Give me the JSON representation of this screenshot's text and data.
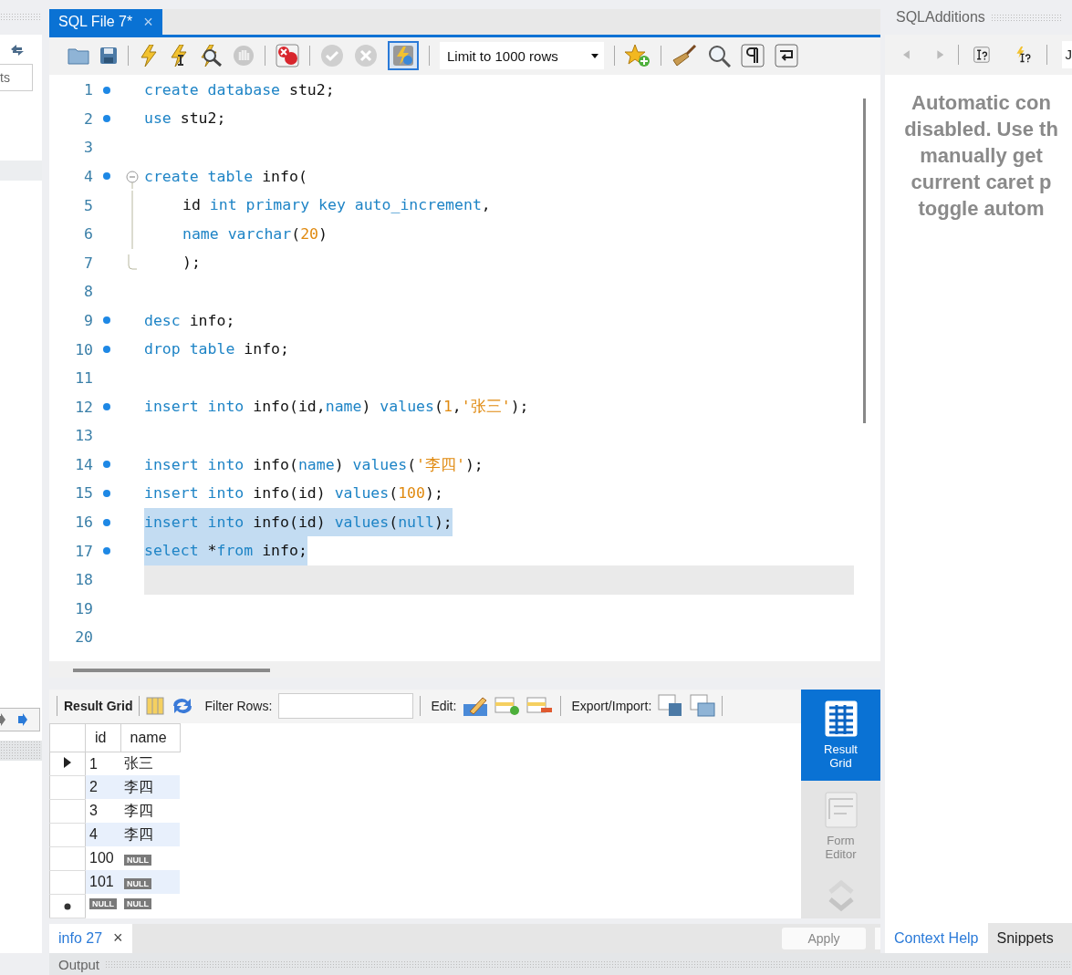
{
  "left_strip": {
    "field_text": "ts"
  },
  "editor_tab": {
    "title": "SQL File 7*",
    "close": "×",
    "selected": true
  },
  "toolbar": {
    "limit": "Limit to 1000 rows"
  },
  "code_lines": [
    {
      "number": "1",
      "kind": "line",
      "marker": true,
      "selected": false,
      "current": false,
      "tokens": [
        {
          "kind": "keyword",
          "text": "create database "
        },
        {
          "kind": "plain",
          "text": "stu2;"
        }
      ]
    },
    {
      "number": "2",
      "kind": "line",
      "marker": true,
      "selected": false,
      "current": false,
      "tokens": [
        {
          "kind": "keyword",
          "text": "use "
        },
        {
          "kind": "plain",
          "text": "stu2;"
        }
      ]
    },
    {
      "number": "3",
      "kind": "line",
      "marker": false,
      "selected": false,
      "current": false
    },
    {
      "number": "4",
      "kind": "fold-start",
      "marker": true,
      "selected": false,
      "current": false,
      "tokens": [
        {
          "kind": "keyword",
          "text": "create table "
        },
        {
          "kind": "plain",
          "text": "info("
        }
      ]
    },
    {
      "number": "5",
      "kind": "fold-inner",
      "marker": false,
      "selected": false,
      "current": false,
      "tokens": [
        {
          "kind": "plain",
          "text": "id "
        },
        {
          "kind": "keyword",
          "text": "int primary key auto_increment"
        },
        {
          "kind": "plain",
          "text": ","
        }
      ]
    },
    {
      "number": "6",
      "kind": "fold-inner",
      "marker": false,
      "selected": false,
      "current": false,
      "tokens": [
        {
          "kind": "keyword",
          "text": "name varchar"
        },
        {
          "kind": "plain",
          "text": "("
        },
        {
          "kind": "literal",
          "text": "20"
        },
        {
          "kind": "plain",
          "text": ")"
        }
      ]
    },
    {
      "number": "7",
      "kind": "fold-end",
      "marker": false,
      "selected": false,
      "current": false,
      "tokens": [
        {
          "kind": "plain",
          "text": ");"
        }
      ]
    },
    {
      "number": "8",
      "kind": "line",
      "marker": false,
      "selected": false,
      "current": false
    },
    {
      "number": "9",
      "kind": "line",
      "marker": true,
      "selected": false,
      "current": false,
      "tokens": [
        {
          "kind": "keyword",
          "text": "desc "
        },
        {
          "kind": "plain",
          "text": "info;"
        }
      ]
    },
    {
      "number": "10",
      "kind": "line",
      "marker": true,
      "selected": false,
      "current": false,
      "tokens": [
        {
          "kind": "keyword",
          "text": "drop table "
        },
        {
          "kind": "plain",
          "text": "info;"
        }
      ]
    },
    {
      "number": "11",
      "kind": "line",
      "marker": false,
      "selected": false,
      "current": false
    },
    {
      "number": "12",
      "kind": "line",
      "marker": true,
      "selected": false,
      "current": false,
      "tokens": [
        {
          "kind": "keyword",
          "text": "insert into "
        },
        {
          "kind": "plain",
          "text": "info(id,"
        },
        {
          "kind": "keyword",
          "text": "name"
        },
        {
          "kind": "plain",
          "text": ") "
        },
        {
          "kind": "keyword",
          "text": "values"
        },
        {
          "kind": "plain",
          "text": "("
        },
        {
          "kind": "literal",
          "text": "1"
        },
        {
          "kind": "plain",
          "text": ","
        },
        {
          "kind": "literal",
          "text": "'张三'"
        },
        {
          "kind": "plain",
          "text": ");"
        }
      ]
    },
    {
      "number": "13",
      "kind": "line",
      "marker": false,
      "selected": false,
      "current": false
    },
    {
      "number": "14",
      "kind": "line",
      "marker": true,
      "selected": false,
      "current": false,
      "tokens": [
        {
          "kind": "keyword",
          "text": "insert into "
        },
        {
          "kind": "plain",
          "text": "info("
        },
        {
          "kind": "keyword",
          "text": "name"
        },
        {
          "kind": "plain",
          "text": ") "
        },
        {
          "kind": "keyword",
          "text": "values"
        },
        {
          "kind": "plain",
          "text": "("
        },
        {
          "kind": "literal",
          "text": "'李四'"
        },
        {
          "kind": "plain",
          "text": ");"
        }
      ]
    },
    {
      "number": "15",
      "kind": "line",
      "marker": true,
      "selected": false,
      "current": false,
      "tokens": [
        {
          "kind": "keyword",
          "text": "insert into "
        },
        {
          "kind": "plain",
          "text": "info(id) "
        },
        {
          "kind": "keyword",
          "text": "values"
        },
        {
          "kind": "plain",
          "text": "("
        },
        {
          "kind": "literal",
          "text": "100"
        },
        {
          "kind": "plain",
          "text": ");"
        }
      ]
    },
    {
      "number": "16",
      "kind": "line",
      "marker": true,
      "selected": true,
      "current": false,
      "tokens": [
        {
          "kind": "keyword",
          "text": "insert into "
        },
        {
          "kind": "plain",
          "text": "info(id) "
        },
        {
          "kind": "keyword",
          "text": "values"
        },
        {
          "kind": "plain",
          "text": "("
        },
        {
          "kind": "keyword",
          "text": "null"
        },
        {
          "kind": "plain",
          "text": ");"
        }
      ]
    },
    {
      "number": "17",
      "kind": "line",
      "marker": true,
      "selected": true,
      "current": false,
      "tokens": [
        {
          "kind": "keyword",
          "text": "select "
        },
        {
          "kind": "plain",
          "text": "*"
        },
        {
          "kind": "keyword",
          "text": "from"
        },
        {
          "kind": "plain",
          "text": " info;"
        }
      ]
    },
    {
      "number": "18",
      "kind": "line",
      "marker": false,
      "selected": false,
      "current": true
    },
    {
      "number": "19",
      "kind": "line",
      "marker": false,
      "selected": false,
      "current": false
    },
    {
      "number": "20",
      "kind": "line",
      "marker": false,
      "selected": false,
      "current": false
    }
  ],
  "result_toolbar": {
    "title": "Result Grid",
    "filter_label": "Filter Rows:",
    "edit_label": "Edit:",
    "export_label": "Export/Import:"
  },
  "result_grid": {
    "columns": [
      "id",
      "name"
    ],
    "rows": [
      {
        "kind": "data",
        "current": true,
        "cells": [
          {
            "kind": "text",
            "text": "1"
          },
          {
            "kind": "text",
            "text": "张三"
          }
        ]
      },
      {
        "kind": "data",
        "current": false,
        "cells": [
          {
            "kind": "text",
            "text": "2"
          },
          {
            "kind": "text",
            "text": "李四"
          }
        ]
      },
      {
        "kind": "data",
        "current": false,
        "cells": [
          {
            "kind": "text",
            "text": "3"
          },
          {
            "kind": "text",
            "text": "李四"
          }
        ]
      },
      {
        "kind": "data",
        "current": false,
        "cells": [
          {
            "kind": "text",
            "text": "4"
          },
          {
            "kind": "text",
            "text": "李四"
          }
        ]
      },
      {
        "kind": "data",
        "current": false,
        "cells": [
          {
            "kind": "text",
            "text": "100"
          },
          {
            "kind": "null",
            "text": "NULL"
          }
        ]
      },
      {
        "kind": "data",
        "current": false,
        "cells": [
          {
            "kind": "text",
            "text": "101"
          },
          {
            "kind": "null",
            "text": "NULL"
          }
        ]
      },
      {
        "kind": "new",
        "current": false,
        "cells": [
          {
            "kind": "null",
            "text": "NULL"
          },
          {
            "kind": "null",
            "text": "NULL"
          }
        ]
      }
    ]
  },
  "view_switcher": [
    {
      "label": "Result Grid",
      "selected": true
    },
    {
      "label": "Form Editor",
      "selected": false
    }
  ],
  "result_tabs": [
    {
      "label": "info 27",
      "close": "×",
      "selected": true
    }
  ],
  "apply_button": "Apply",
  "output_panel": {
    "title": "Output"
  },
  "side_panel": {
    "title": "SQLAdditions",
    "jump": "J",
    "help_lines": [
      "Automatic con",
      "disabled. Use th",
      "manually get",
      "current caret p",
      "toggle autom"
    ],
    "tabs": [
      {
        "label": "Context Help",
        "selected": true
      },
      {
        "label": "Snippets",
        "selected": false
      }
    ]
  }
}
